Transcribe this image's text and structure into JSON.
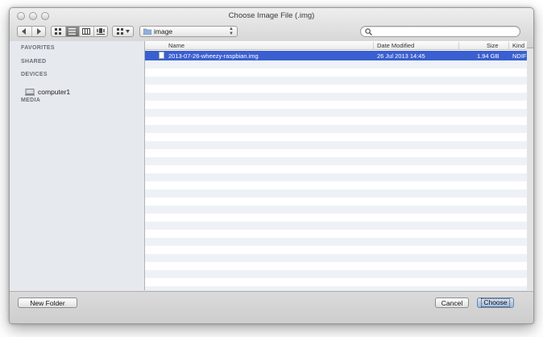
{
  "window": {
    "title": "Choose Image File (.img)"
  },
  "toolbar": {
    "back_icon": "chevron-left-icon",
    "forward_icon": "chevron-right-icon",
    "view_modes": [
      "icon-view-icon",
      "list-view-icon",
      "column-view-icon",
      "coverflow-view-icon"
    ],
    "active_view": "list-view-icon",
    "arrange_icon": "arrange-grid-icon",
    "path_folder": "image",
    "search_placeholder": ""
  },
  "sidebar": {
    "sections": [
      {
        "heading": "FAVORITES"
      },
      {
        "heading": "SHARED"
      },
      {
        "heading": "DEVICES"
      },
      {
        "heading": "MEDIA"
      }
    ],
    "device_item": "computer1"
  },
  "file_list": {
    "columns": [
      "Name",
      "Date Modified",
      "Size",
      "Kind"
    ],
    "rows": [
      {
        "name": "2013-07-26-wheezy-raspbian.img",
        "date_modified": "26 Jul 2013 14:45",
        "size": "1.94 GB",
        "kind": "NDIF"
      }
    ],
    "selection_color": "#3a5fd0"
  },
  "buttons": {
    "new_folder": "New Folder",
    "cancel": "Cancel",
    "choose": "Choose"
  }
}
